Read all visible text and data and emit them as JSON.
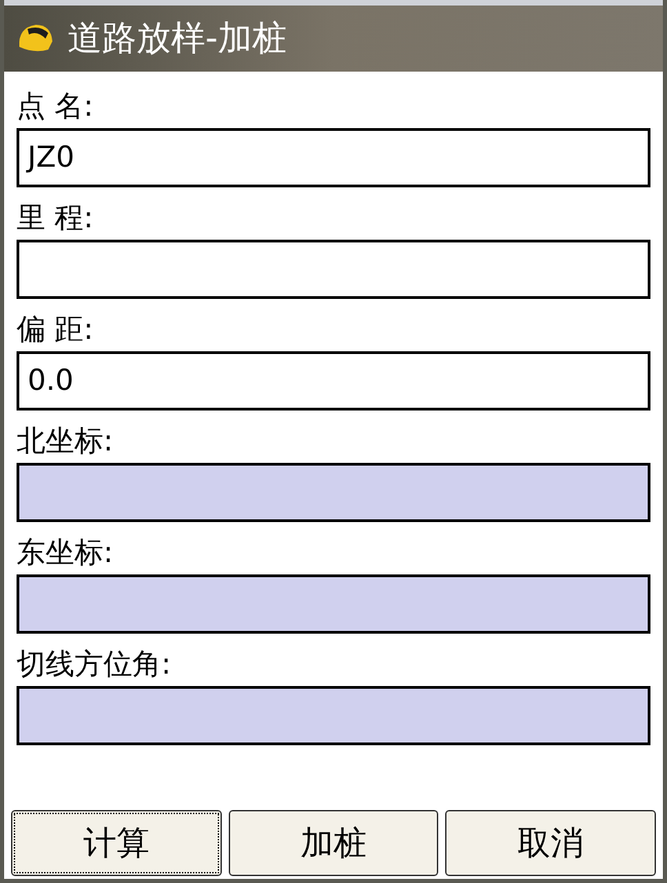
{
  "window": {
    "title": "道路放样-加桩"
  },
  "fields": [
    {
      "label": "点 名:",
      "value": "JZ0",
      "readonly": false
    },
    {
      "label": "里 程:",
      "readonly": false
    },
    {
      "label": "偏 距:",
      "value": "0.0",
      "readonly": false
    },
    {
      "label": "北坐标:",
      "readonly": true
    },
    {
      "label": "东坐标:",
      "readonly": true
    },
    {
      "label": "切线方位角:",
      "readonly": true
    }
  ],
  "buttons": [
    {
      "label": "计算",
      "focused": true
    },
    {
      "label": "加桩",
      "focused": false
    },
    {
      "label": "取消",
      "focused": false
    }
  ]
}
